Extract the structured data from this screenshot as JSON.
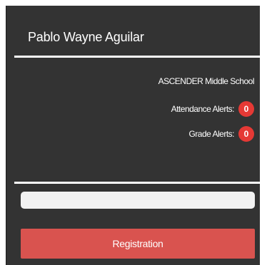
{
  "student": {
    "name": "Pablo Wayne Aguilar",
    "school": "ASCENDER Middle School"
  },
  "alerts": {
    "attendance_label": "Attendance Alerts:",
    "attendance_count": "0",
    "grade_label": "Grade Alerts:",
    "grade_count": "0"
  },
  "search": {
    "placeholder": "",
    "value": ""
  },
  "actions": {
    "registration_label": "Registration"
  },
  "colors": {
    "panel_background": "#333333",
    "badge": "#e53935",
    "button": "#d9534f"
  }
}
